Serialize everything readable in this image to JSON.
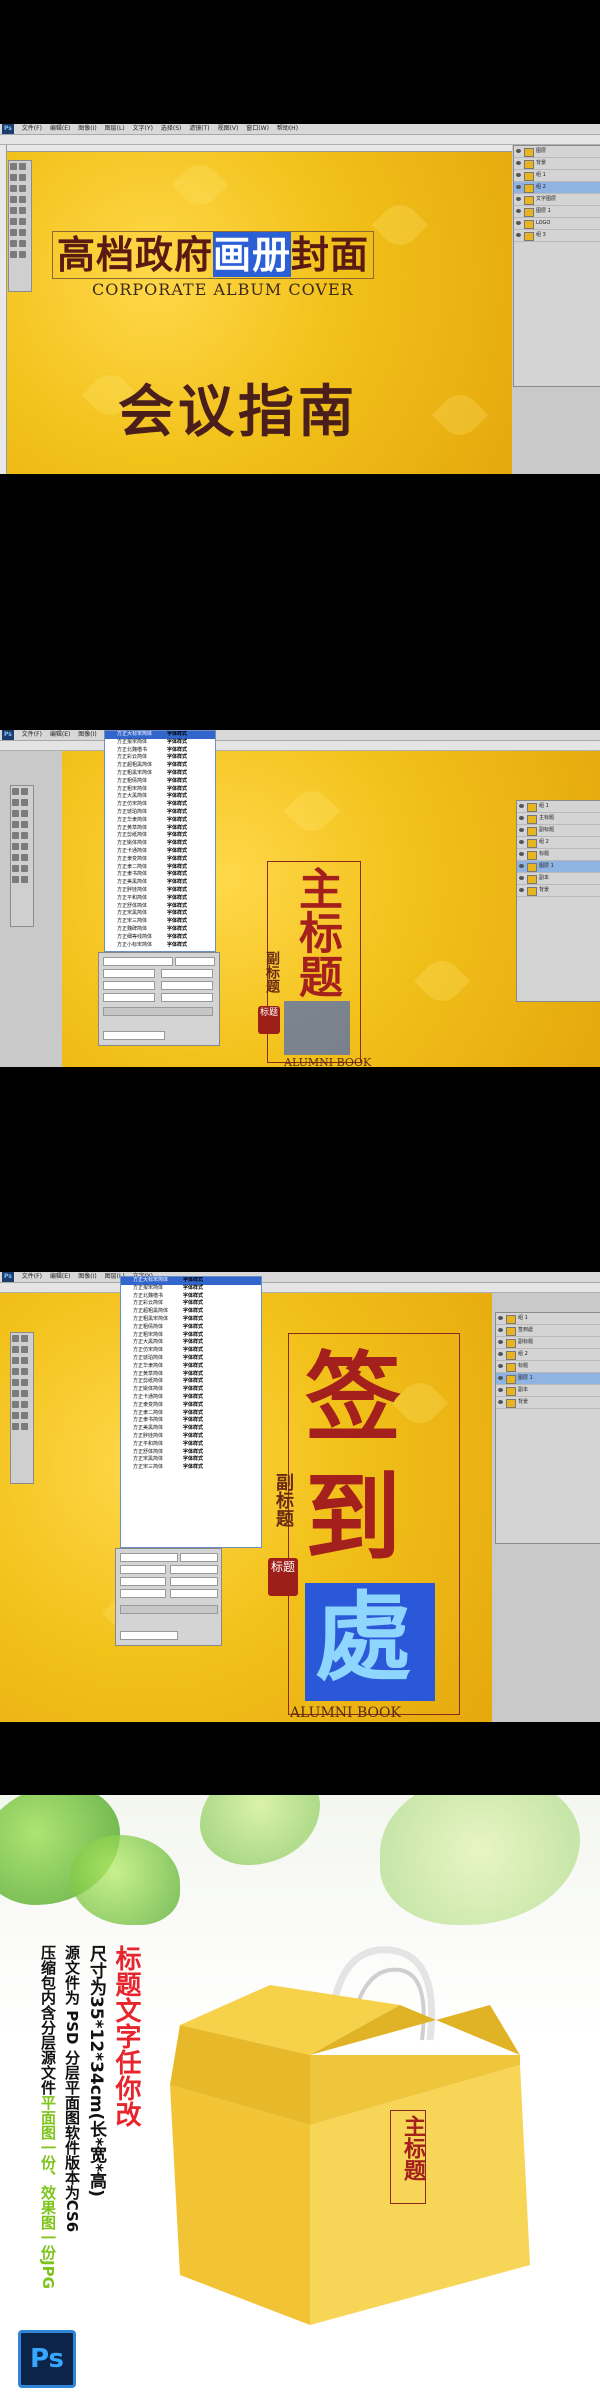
{
  "photoshop": {
    "app_badge": "Ps",
    "menu_items": [
      "文件(F)",
      "编辑(E)",
      "图像(I)",
      "图层(L)",
      "文字(Y)",
      "选择(S)",
      "滤镜(T)",
      "视图(V)",
      "窗口(W)",
      "帮助(H)"
    ]
  },
  "section1": {
    "title_part1": "高档政府",
    "title_selected": "画册",
    "title_part3": "封面",
    "subtitle": "CORPORATE ALBUM COVER",
    "heading": "会议指南",
    "layers_panel_items": [
      "图层",
      "背景",
      "组 1",
      "组 2",
      "文字图层",
      "图层 1",
      "LOGO",
      "组 3"
    ]
  },
  "section2": {
    "main_title": "主标题",
    "sub_title": "副标题",
    "seal_text": "标题",
    "english_line": "ALUMNI BOOK",
    "font_list_items": [
      "方正大标宋简体",
      "方正报宋简体",
      "方正北魏楷书",
      "方正彩云简体",
      "方正超粗黑简体",
      "方正粗黑宋简体",
      "方正粗倩简体",
      "方正粗宋简体",
      "方正大黑简体",
      "方正仿宋简体",
      "方正琥珀简体",
      "方正华隶简体",
      "方正黄草简体",
      "方正剪纸简体",
      "方正姚体简体",
      "方正卡通简体",
      "方正隶变简体",
      "方正隶二简体",
      "方正隶书简体",
      "方正美黑简体",
      "方正胖娃简体",
      "方正平和简体",
      "方正舒体简体",
      "方正宋黑简体",
      "方正宋三简体",
      "方正魏碑简体",
      "方正细等线简体",
      "方正小标宋简体",
      "方正新舒体简体",
      "方正行楷简体",
      "方正硬笔行书简体",
      "方正稚艺简体"
    ],
    "font_preview": "字体样式",
    "layers_panel_items": [
      "组 1",
      "主标题",
      "副标题",
      "组 2",
      "标题",
      "图层 1",
      "副本",
      "背景"
    ]
  },
  "section3": {
    "char1": "签",
    "char2": "到",
    "char3": "處",
    "sub_title": "副标题",
    "seal_text": "标题",
    "english_line": "ALUMNI BOOK",
    "font_list_items": [
      "方正大标宋简体",
      "方正报宋简体",
      "方正北魏楷书",
      "方正彩云简体",
      "方正超粗黑简体",
      "方正粗黑宋简体",
      "方正粗倩简体",
      "方正粗宋简体",
      "方正大黑简体",
      "方正仿宋简体",
      "方正琥珀简体",
      "方正华隶简体",
      "方正黄草简体",
      "方正剪纸简体",
      "方正姚体简体",
      "方正卡通简体",
      "方正隶变简体",
      "方正隶二简体",
      "方正隶书简体",
      "方正美黑简体",
      "方正胖娃简体",
      "方正平和简体",
      "方正舒体简体",
      "方正宋黑简体",
      "方正宋三简体"
    ],
    "font_preview": "字体样式",
    "layers_panel_items": [
      "组 1",
      "签到處",
      "副标题",
      "组 2",
      "标题",
      "图层 1",
      "副本",
      "背景"
    ]
  },
  "section4": {
    "headline": "标题文字任你改",
    "size_line": "尺寸为35*12*34cm(长*宽*高)",
    "source_line": "源文件为 PSD 分层平面图软件版本为CS6",
    "package_line_a": "压缩包内含分层源文件",
    "package_line_b": "平面图一份、效果图一份JPG",
    "box_title": "主标题",
    "ps_badge": "Ps",
    "colors": {
      "headline": "#e8252c",
      "highlight": "#7fc31c",
      "text": "#111111"
    }
  }
}
